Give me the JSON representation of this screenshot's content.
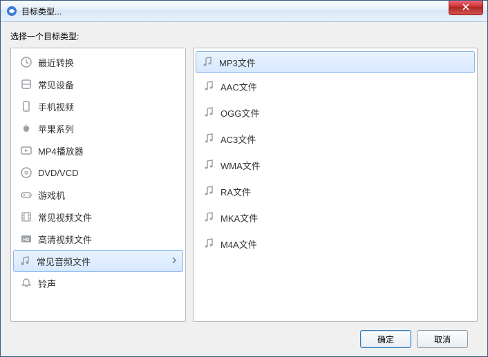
{
  "window": {
    "title": "目标类型..."
  },
  "prompt": "选择一个目标类型:",
  "categories": {
    "selectedIndex": 8,
    "items": [
      {
        "label": "最近转换",
        "icon": "clock-icon"
      },
      {
        "label": "常见设备",
        "icon": "device-icon"
      },
      {
        "label": "手机视频",
        "icon": "phone-icon"
      },
      {
        "label": "苹果系列",
        "icon": "apple-icon"
      },
      {
        "label": "MP4播放器",
        "icon": "mp4-icon"
      },
      {
        "label": "DVD/VCD",
        "icon": "disc-icon"
      },
      {
        "label": "游戏机",
        "icon": "gamepad-icon"
      },
      {
        "label": "常见视频文件",
        "icon": "film-icon"
      },
      {
        "label": "常见音频文件",
        "icon": "music-icon"
      },
      {
        "label": "高清视频文件",
        "icon": "hd-icon"
      },
      {
        "label": "铃声",
        "icon": "bell-icon"
      }
    ]
  },
  "formats": {
    "selectedIndex": 0,
    "items": [
      {
        "label": "MP3文件"
      },
      {
        "label": "AAC文件"
      },
      {
        "label": "OGG文件"
      },
      {
        "label": "AC3文件"
      },
      {
        "label": "WMA文件"
      },
      {
        "label": "RA文件"
      },
      {
        "label": "MKA文件"
      },
      {
        "label": "M4A文件"
      }
    ]
  },
  "buttons": {
    "ok": "确定",
    "cancel": "取消"
  }
}
